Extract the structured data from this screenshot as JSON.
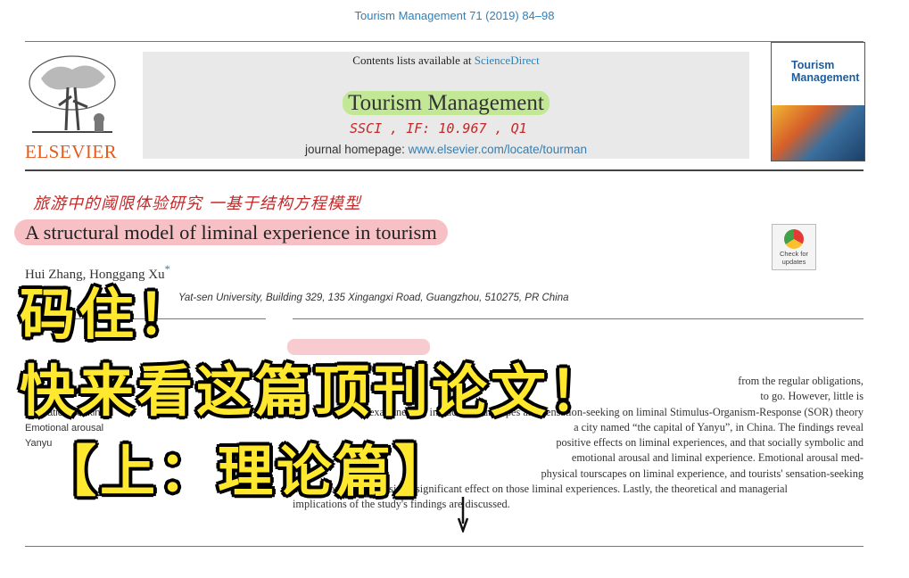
{
  "header": {
    "journal_ref": "Tourism Management 71 (2019) 84–98",
    "contents_prefix": "Contents lists available at ",
    "contents_link": "ScienceDirect",
    "journal_name": "Tourism Management",
    "homepage_prefix": "journal homepage: ",
    "homepage_link": "www.elsevier.com/locate/tourman",
    "publisher": "ELSEVIER",
    "cover_title_line1": "Tourism",
    "cover_title_line2": "Management"
  },
  "handwritten": {
    "journal_note": "SSCI , IF: 10.967 , Q1",
    "title_translation": "旅游中的阈限体验研究 一基于结构方程模型"
  },
  "article": {
    "title": "A structural model of liminal experience in tourism",
    "authors": "Hui Zhang, Honggang Xu",
    "author_star": "*",
    "affiliation": "Yat-sen University, Building 329, 135 Xingangxi Road, Guangzhou, 510275, PR China",
    "check_updates": "Check for updates",
    "keywords": [
      "Sensation-seeking",
      "Emotional arousal",
      "Yanyu"
    ],
    "abstract_lines": [
      "from the regular obligations,",
      "to go. However, little is",
      "examines the impact of tourscapes and sensation-seeking on liminal  Stimulus-Organism-Response (SOR) theory",
      "a city named “the capital of Yanyu”, in China. The findings reveal",
      "positive effects on liminal experiences, and that socially symbolic and",
      "emotional arousal and liminal experience. Emotional arousal med-",
      "physical tourscapes on liminal experience, and tourists' sensation-seeking",
      "motivations have a positive significant effect on those liminal experiences. Lastly, the theoretical and managerial",
      "implications of the study's findings are discussed."
    ]
  },
  "overlay": {
    "line1": "码住！",
    "line2": "快来看这篇顶刊论文！",
    "line3": "【上：理论篇】"
  },
  "colors": {
    "link": "#2f80b8",
    "elsevier_orange": "#e85a1a",
    "overlay_yellow": "#ffe82e",
    "handwriting_red": "#c62828"
  }
}
